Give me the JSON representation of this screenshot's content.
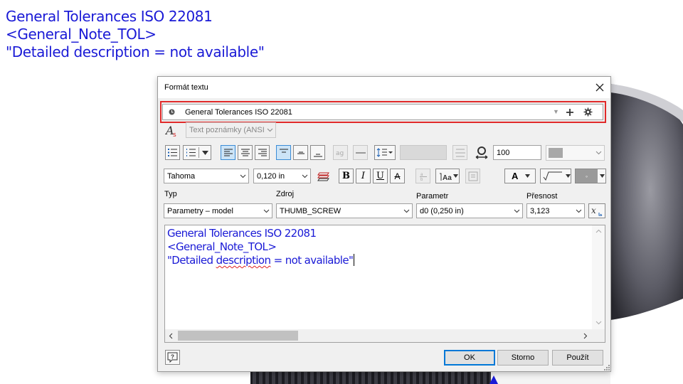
{
  "background": {
    "lines": [
      "General Tolerances ISO 22081",
      "<General_Note_TOL>",
      "\"Detailed description = not available\""
    ]
  },
  "dialog": {
    "title": "Formát textu",
    "style_value": "General Tolerances ISO 22081",
    "text_style_value": "Text poznámky (ANSI",
    "stretch_value": "100",
    "font_value": "Tahoma",
    "font_size_value": "0,120 in",
    "bold_label": "B",
    "italic_label": "I",
    "underline_label": "U",
    "strike_label": "A",
    "color_label": "A",
    "labels": {
      "type": "Typ",
      "source": "Zdroj",
      "parameter": "Parametr",
      "precision": "Přesnost"
    },
    "type_value": "Parametry – model",
    "source_value": "THUMB_SCREW",
    "parameter_value": "d0 (0,250 in)",
    "precision_value": "3,123",
    "editor": {
      "line1": "General Tolerances ISO 22081",
      "line2": "<General_Note_TOL>",
      "line3_pre": "\"Detailed ",
      "line3_err": "description",
      "line3_post": " = not available\""
    },
    "buttons": {
      "ok": "OK",
      "cancel": "Storno",
      "apply": "Použít"
    }
  },
  "colors": {
    "text_blue": "#1a1ad6",
    "highlight_red": "#e02a2a",
    "accent": "#0078d7"
  }
}
